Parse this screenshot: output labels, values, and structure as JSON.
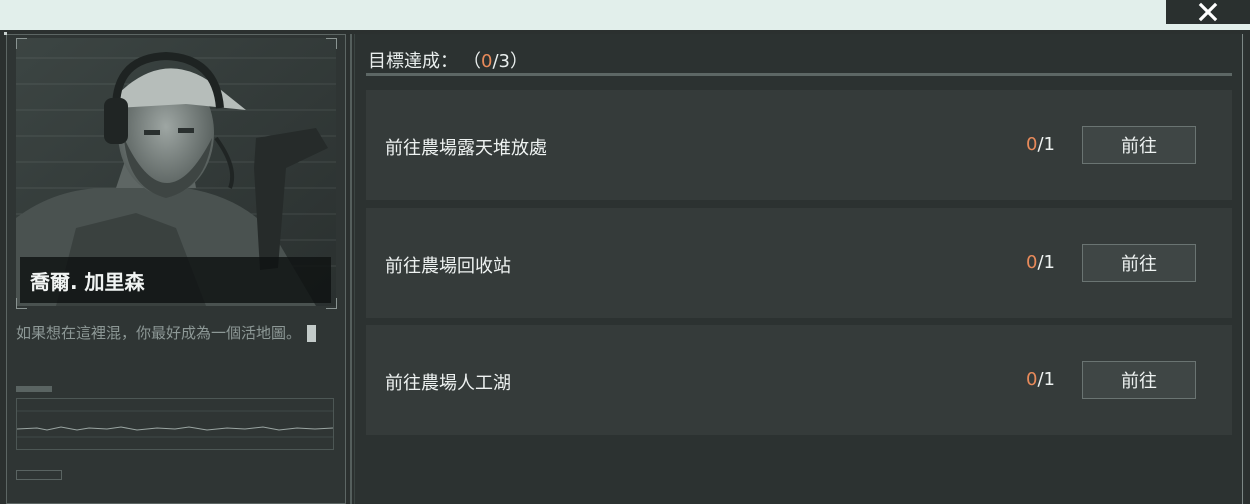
{
  "window": {
    "close_symbol": "✕"
  },
  "character": {
    "name": "喬爾. 加里森",
    "quote": "如果想在這裡混，你最好成為一個活地圖。"
  },
  "objectives": {
    "title": "目標達成：",
    "progress_open": "（",
    "done": "0",
    "total_suffix": "/3）"
  },
  "tasks": [
    {
      "label": "前往農場露天堆放處",
      "done": "0",
      "total_suffix": "/1",
      "button": "前往"
    },
    {
      "label": "前往農場回收站",
      "done": "0",
      "total_suffix": "/1",
      "button": "前往"
    },
    {
      "label": "前往農場人工湖",
      "done": "0",
      "total_suffix": "/1",
      "button": "前往"
    }
  ],
  "colors": {
    "accent": "#e88a5a",
    "panel": "#2b302f",
    "row": "#353b3a"
  }
}
